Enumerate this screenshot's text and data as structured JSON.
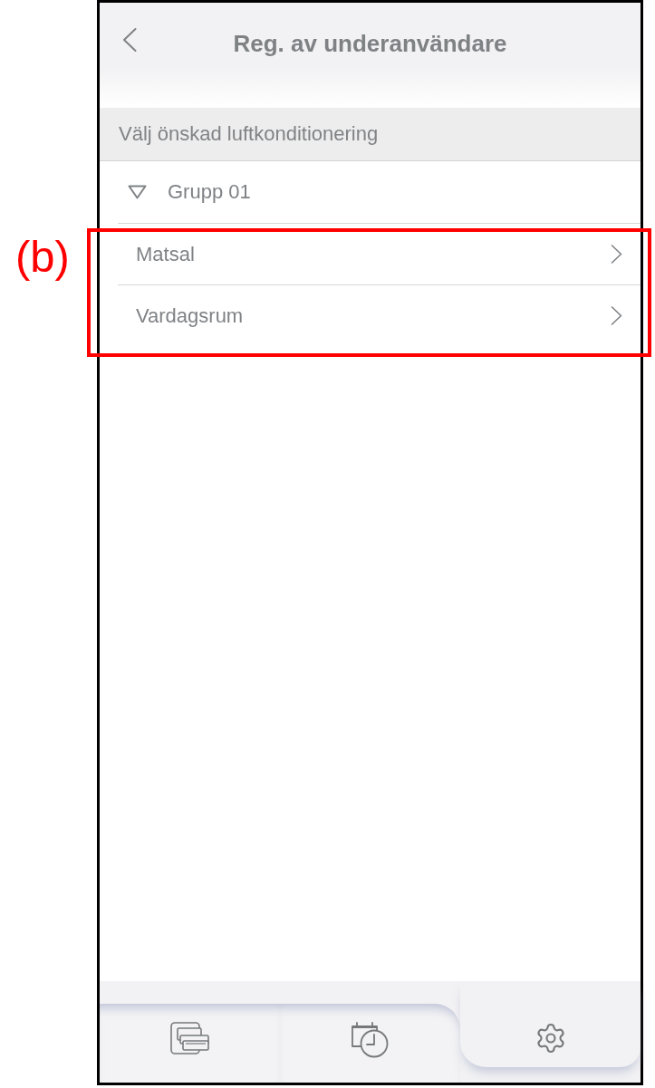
{
  "figure_label": "(b)",
  "header": {
    "title": "Reg. av underanvändare"
  },
  "section": {
    "title": "Välj önskad luftkonditionering"
  },
  "groups": [
    {
      "name": "Grupp 01",
      "expanded": true,
      "highlighted": true,
      "children": [
        {
          "name": "Matsal"
        },
        {
          "name": "Vardagsrum"
        }
      ]
    }
  ],
  "nav_tabs": [
    {
      "kind": "devices",
      "selected": false
    },
    {
      "kind": "schedule",
      "selected": false
    },
    {
      "kind": "settings",
      "selected": true
    }
  ]
}
